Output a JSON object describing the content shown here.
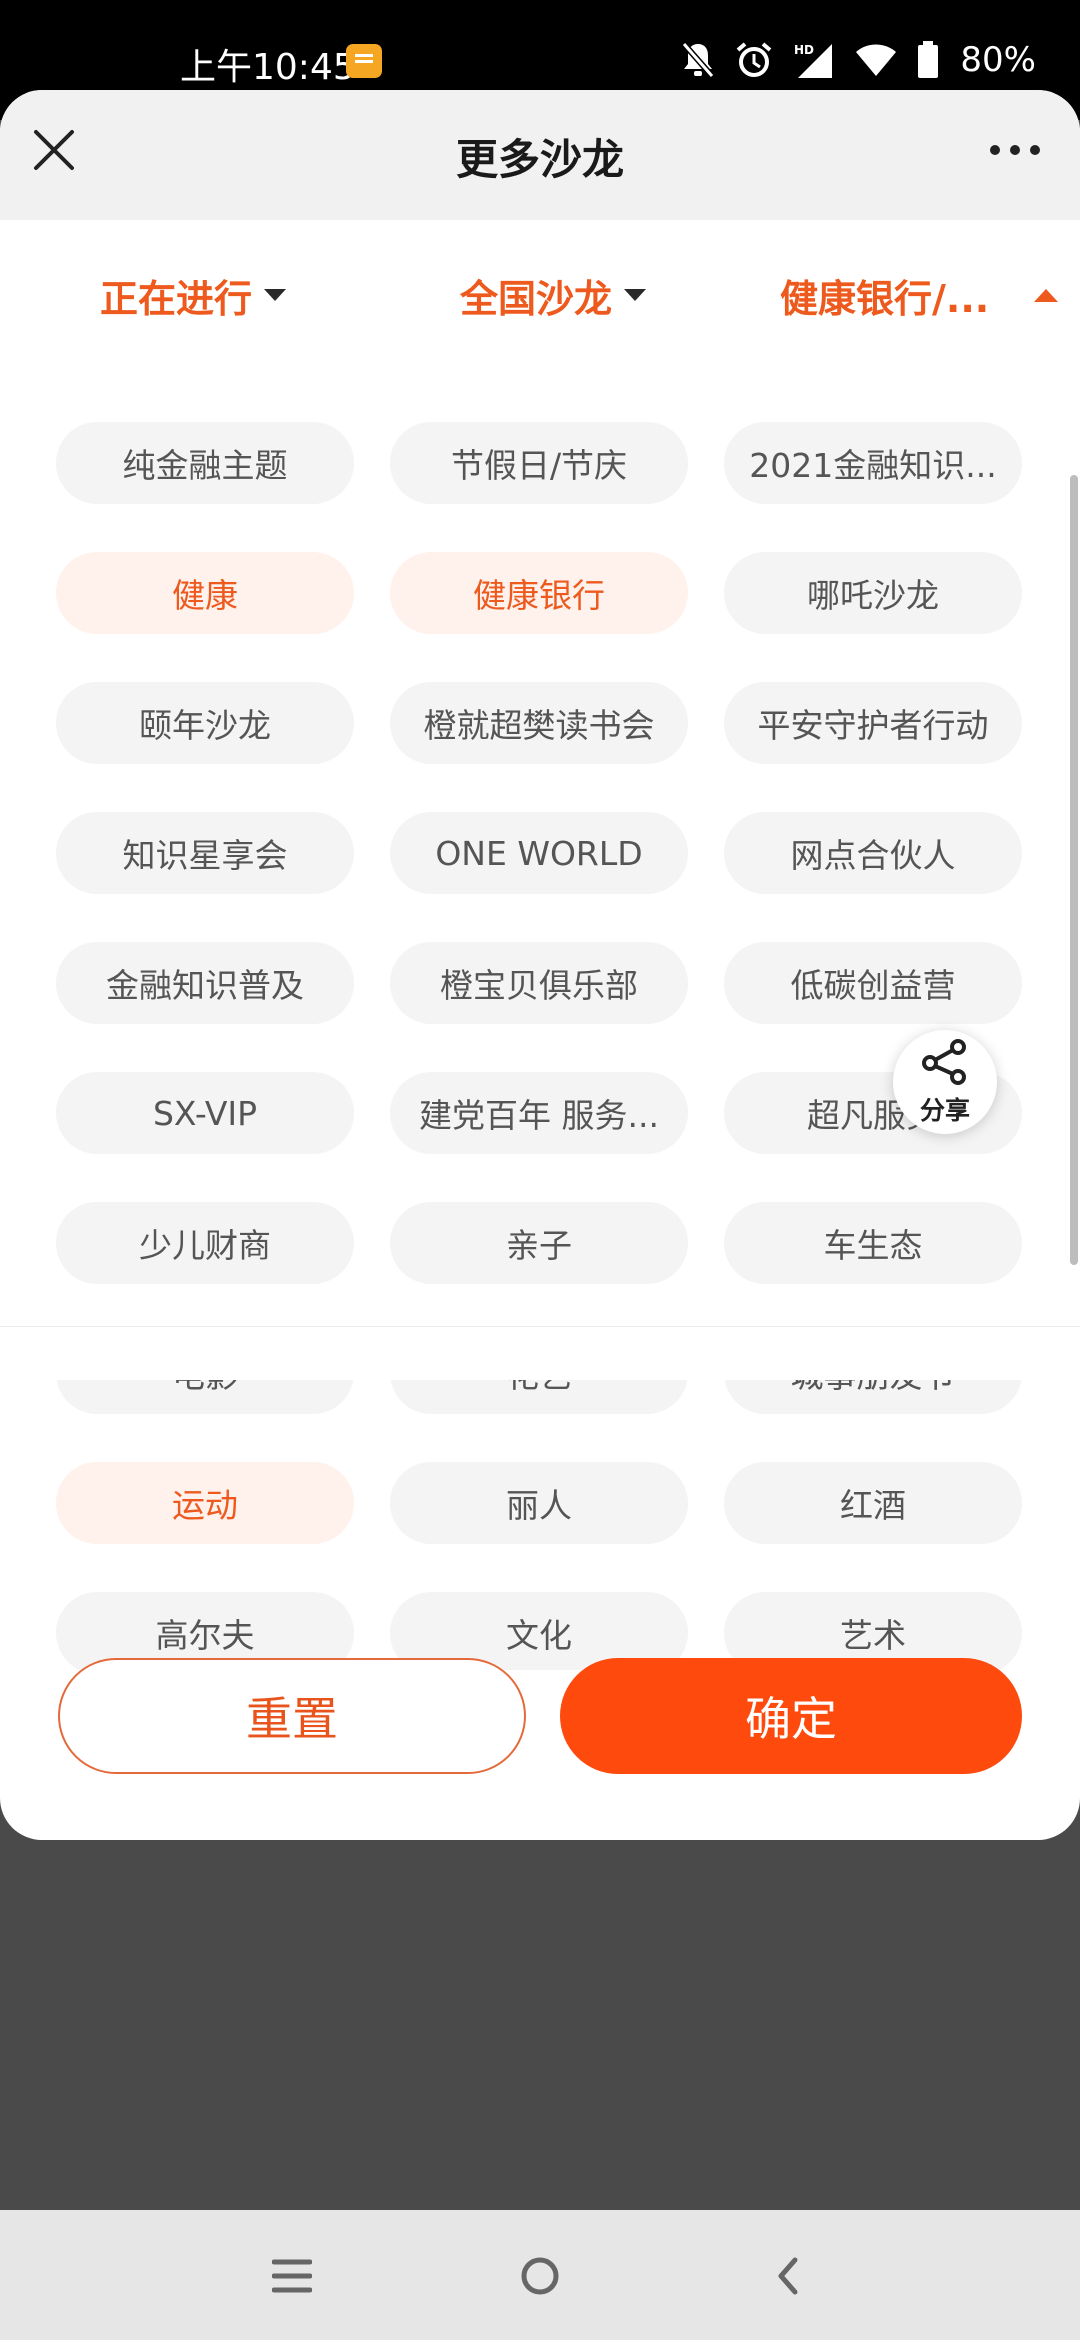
{
  "status_bar": {
    "time": "上午10:45",
    "battery": "80%"
  },
  "header": {
    "title": "更多沙龙"
  },
  "filters": [
    {
      "label": "正在进行",
      "state": "collapsed"
    },
    {
      "label": "全国沙龙",
      "state": "collapsed"
    },
    {
      "label": "健康银行/...",
      "state": "expanded"
    }
  ],
  "tags": [
    {
      "label": "纯金融主题",
      "selected": false
    },
    {
      "label": "节假日/节庆",
      "selected": false
    },
    {
      "label": "2021金融知识...",
      "selected": false
    },
    {
      "label": "健康",
      "selected": true
    },
    {
      "label": "健康银行",
      "selected": true
    },
    {
      "label": "哪吒沙龙",
      "selected": false
    },
    {
      "label": "颐年沙龙",
      "selected": false
    },
    {
      "label": "橙就超樊读书会",
      "selected": false
    },
    {
      "label": "平安守护者行动",
      "selected": false
    },
    {
      "label": "知识星享会",
      "selected": false
    },
    {
      "label": "ONE WORLD",
      "selected": false
    },
    {
      "label": "网点合伙人",
      "selected": false
    },
    {
      "label": "金融知识普及",
      "selected": false
    },
    {
      "label": "橙宝贝俱乐部",
      "selected": false
    },
    {
      "label": "低碳创益营",
      "selected": false
    },
    {
      "label": "SX-VIP",
      "selected": false
    },
    {
      "label": "建党百年 服务...",
      "selected": false
    },
    {
      "label": "超凡服务",
      "selected": false
    },
    {
      "label": "少儿财商",
      "selected": false
    },
    {
      "label": "亲子",
      "selected": false
    },
    {
      "label": "车生态",
      "selected": false
    },
    {
      "label": "电影",
      "selected": false
    },
    {
      "label": "花艺",
      "selected": false
    },
    {
      "label": "城事朋友节",
      "selected": false
    },
    {
      "label": "运动",
      "selected": true
    },
    {
      "label": "丽人",
      "selected": false
    },
    {
      "label": "红酒",
      "selected": false
    },
    {
      "label": "高尔夫",
      "selected": false
    },
    {
      "label": "文化",
      "selected": false
    },
    {
      "label": "艺术",
      "selected": false
    }
  ],
  "share": {
    "label": "分享"
  },
  "actions": {
    "reset_label": "重置",
    "confirm_label": "确定"
  },
  "colors": {
    "accent": "#ee5a1e",
    "confirm_bg": "#ff4a0d",
    "selected_tag_bg": "#fff1ec",
    "tag_bg": "#f4f4f4"
  }
}
